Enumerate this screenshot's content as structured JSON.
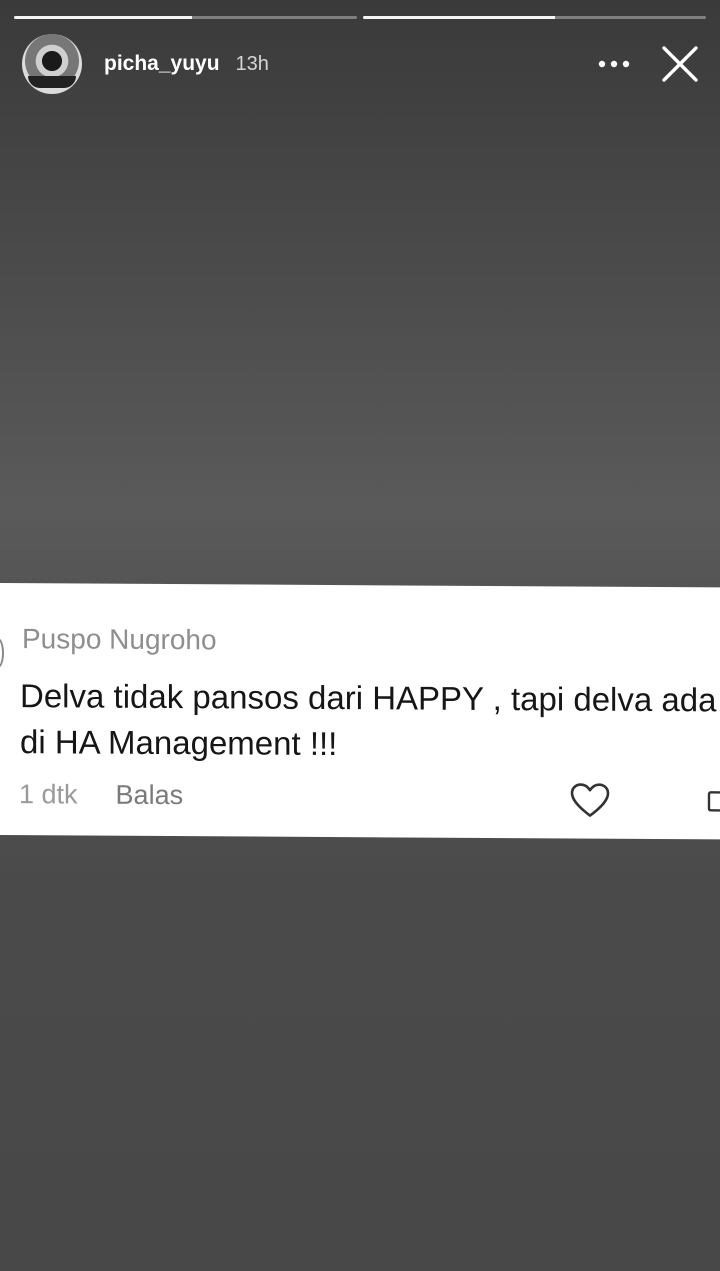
{
  "story": {
    "progress": [
      0.52,
      0.56
    ],
    "username": "picha_yuyu",
    "timestamp": "13h",
    "icons": {
      "more": "more-horizontal-icon",
      "close": "close-icon"
    }
  },
  "comment": {
    "author": "Puspo Nugroho",
    "text": "Delva tidak pansos dari HAPPY , tapi delva ada di HA Management !!!",
    "time": "1 dtk",
    "reply_label": "Balas",
    "like_icon": "heart-outline-icon"
  }
}
